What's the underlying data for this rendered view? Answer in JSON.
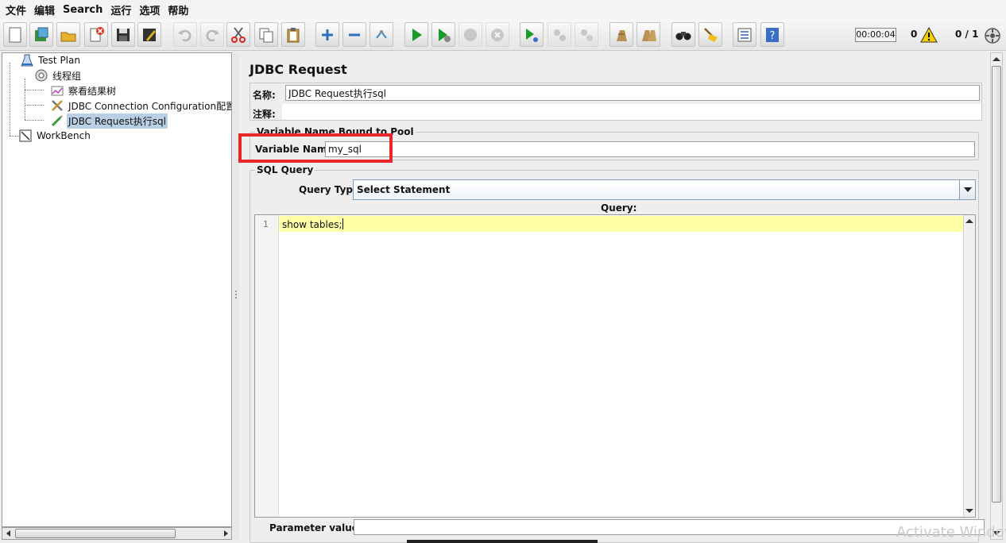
{
  "menu": [
    "文件",
    "编辑",
    "Search",
    "运行",
    "选项",
    "帮助"
  ],
  "toolbar": {
    "buttons": [
      {
        "icon": "new-icon"
      },
      {
        "icon": "templates-icon"
      },
      {
        "icon": "open-icon"
      },
      {
        "icon": "close-icon"
      },
      {
        "icon": "save-icon"
      },
      {
        "icon": "save-as-icon"
      },
      {
        "icon": "undo-icon"
      },
      {
        "icon": "redo-icon"
      },
      {
        "icon": "cut-icon"
      },
      {
        "icon": "copy-icon"
      },
      {
        "icon": "paste-icon"
      },
      {
        "icon": "expand-icon"
      },
      {
        "icon": "collapse-icon"
      },
      {
        "icon": "toggle-icon"
      },
      {
        "icon": "start-icon"
      },
      {
        "icon": "start-no-pause-icon"
      },
      {
        "icon": "stop-icon"
      },
      {
        "icon": "shutdown-icon"
      },
      {
        "icon": "remote-start-icon"
      },
      {
        "icon": "remote-stop-icon"
      },
      {
        "icon": "remote-shutdown-icon"
      },
      {
        "icon": "clear-icon"
      },
      {
        "icon": "clear-all-icon"
      },
      {
        "icon": "search-icon"
      },
      {
        "icon": "reset-search-icon"
      },
      {
        "icon": "function-helper-icon"
      },
      {
        "icon": "help-icon"
      }
    ],
    "timer": "00:00:04",
    "error_count": "0",
    "threads": "0 / 1"
  },
  "tree": {
    "items": [
      {
        "label": "Test Plan",
        "icon": "test-plan-icon"
      },
      {
        "label": "线程组",
        "icon": "thread-group-icon"
      },
      {
        "label": "察看结果树",
        "icon": "listener-icon"
      },
      {
        "label": "JDBC Connection Configuration配置数",
        "icon": "config-element-icon"
      },
      {
        "label": "JDBC Request执行sql",
        "icon": "sampler-icon",
        "selected": true
      },
      {
        "label": "WorkBench",
        "icon": "workbench-icon"
      }
    ]
  },
  "panel": {
    "title": "JDBC Request",
    "name_label": "名称:",
    "name_value": "JDBC Request执行sql",
    "comment_label": "注释:",
    "comment_value": "",
    "var_group_title": "Variable Name Bound to Pool",
    "var_name_label": "Variable Name:",
    "var_name_value": "my_sql",
    "sql_group_title": "SQL Query",
    "query_type_label": "Query Type:",
    "query_type_value": "Select Statement",
    "query_label": "Query:",
    "line_number": "1",
    "query_text": "show tables;",
    "param_values_label": "Parameter values:",
    "param_values_value": ""
  },
  "watermark": "Activate Windows",
  "colors": {
    "highlight_box": "#e8262c",
    "selected_row": "#b8cfe5",
    "current_line": "#ffffa8"
  }
}
